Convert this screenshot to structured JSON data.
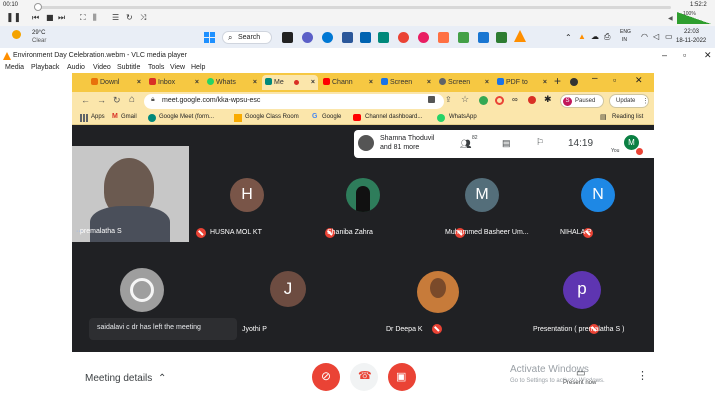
{
  "vlc": {
    "time_elapsed": "00:10",
    "time_total": "1:52:2",
    "volume": "100%",
    "window_title": "Environment Day Celebration.webm - VLC media player",
    "menu": [
      "Media",
      "Playback",
      "Audio",
      "Video",
      "Subtitle",
      "Tools",
      "View",
      "Help"
    ]
  },
  "taskbar": {
    "weather_temp": "29°C",
    "weather_desc": "Clear",
    "search_label": "Search",
    "lang_top": "ENG",
    "lang_bottom": "IN",
    "clock_time": "22:03",
    "clock_date": "18-11-2022"
  },
  "browser": {
    "tabs": [
      {
        "label": "Downl",
        "color": "#e8710a",
        "active": false
      },
      {
        "label": "Inbox",
        "color": "#d93025",
        "active": false
      },
      {
        "label": "Whats",
        "color": "#25d366",
        "active": false
      },
      {
        "label": "Me",
        "color": "#00897b",
        "active": true
      },
      {
        "label": "Chann",
        "color": "#ff0000",
        "active": false
      },
      {
        "label": "Screen",
        "color": "#1a73e8",
        "active": false
      },
      {
        "label": "Screen",
        "color": "#5f6368",
        "active": false
      },
      {
        "label": "PDF to",
        "color": "#1a73e8",
        "active": false
      }
    ],
    "url": "meet.google.com/kka-wpsu-esc",
    "profile_status": "Paused",
    "update_label": "Update",
    "bookmarks": [
      {
        "label": "Apps",
        "color": "#5f6368"
      },
      {
        "label": "Gmail",
        "color": "#d93025"
      },
      {
        "label": "Google Meet (form...",
        "color": "#00897b"
      },
      {
        "label": "Google Class Room",
        "color": "#f9ab00"
      },
      {
        "label": "Google",
        "color": "#4285f4"
      },
      {
        "label": "Channel dashboard...",
        "color": "#ff0000"
      },
      {
        "label": "WhatsApp",
        "color": "#25d366"
      }
    ],
    "reading_list": "Reading list"
  },
  "meet": {
    "presenter_line1": "Shamna Thoduvil",
    "presenter_line2": "and 81 more",
    "participants_count": "82",
    "time": "14:19",
    "you_label": "You",
    "you_initial": "M",
    "participants": [
      {
        "name": "premalatha S",
        "initial": "",
        "color": "#777"
      },
      {
        "name": "HUSNA MOL KT",
        "initial": "H",
        "color": "#795548"
      },
      {
        "name": "Shaniba Zahra",
        "initial": "",
        "color": "#2e7d5b"
      },
      {
        "name": "Muhammed Basheer Um...",
        "initial": "M",
        "color": "#546e7a"
      },
      {
        "name": "NIHALA P",
        "initial": "N",
        "color": "#1e88e5"
      },
      {
        "name": "",
        "initial": "",
        "color": "#9e9e9e"
      },
      {
        "name": "Jyothi P",
        "initial": "J",
        "color": "#6d4c41"
      },
      {
        "name": "Dr Deepa K",
        "initial": "",
        "color": "#c77b3a"
      },
      {
        "name": "Presentation ( premalatha S )",
        "initial": "p",
        "color": "#5e35b1"
      }
    ],
    "toast": "saidalavi c dr has left the meeting",
    "meeting_details": "Meeting details",
    "present_now": "Present now",
    "activate_title": "Activate Windows",
    "activate_sub": "Go to Settings to activate Windows."
  },
  "colors": {
    "tab_strip": "#f6c842",
    "toolbar": "#fbe6ab",
    "meet_bg": "#202124",
    "mic_off": "#ea4335"
  }
}
